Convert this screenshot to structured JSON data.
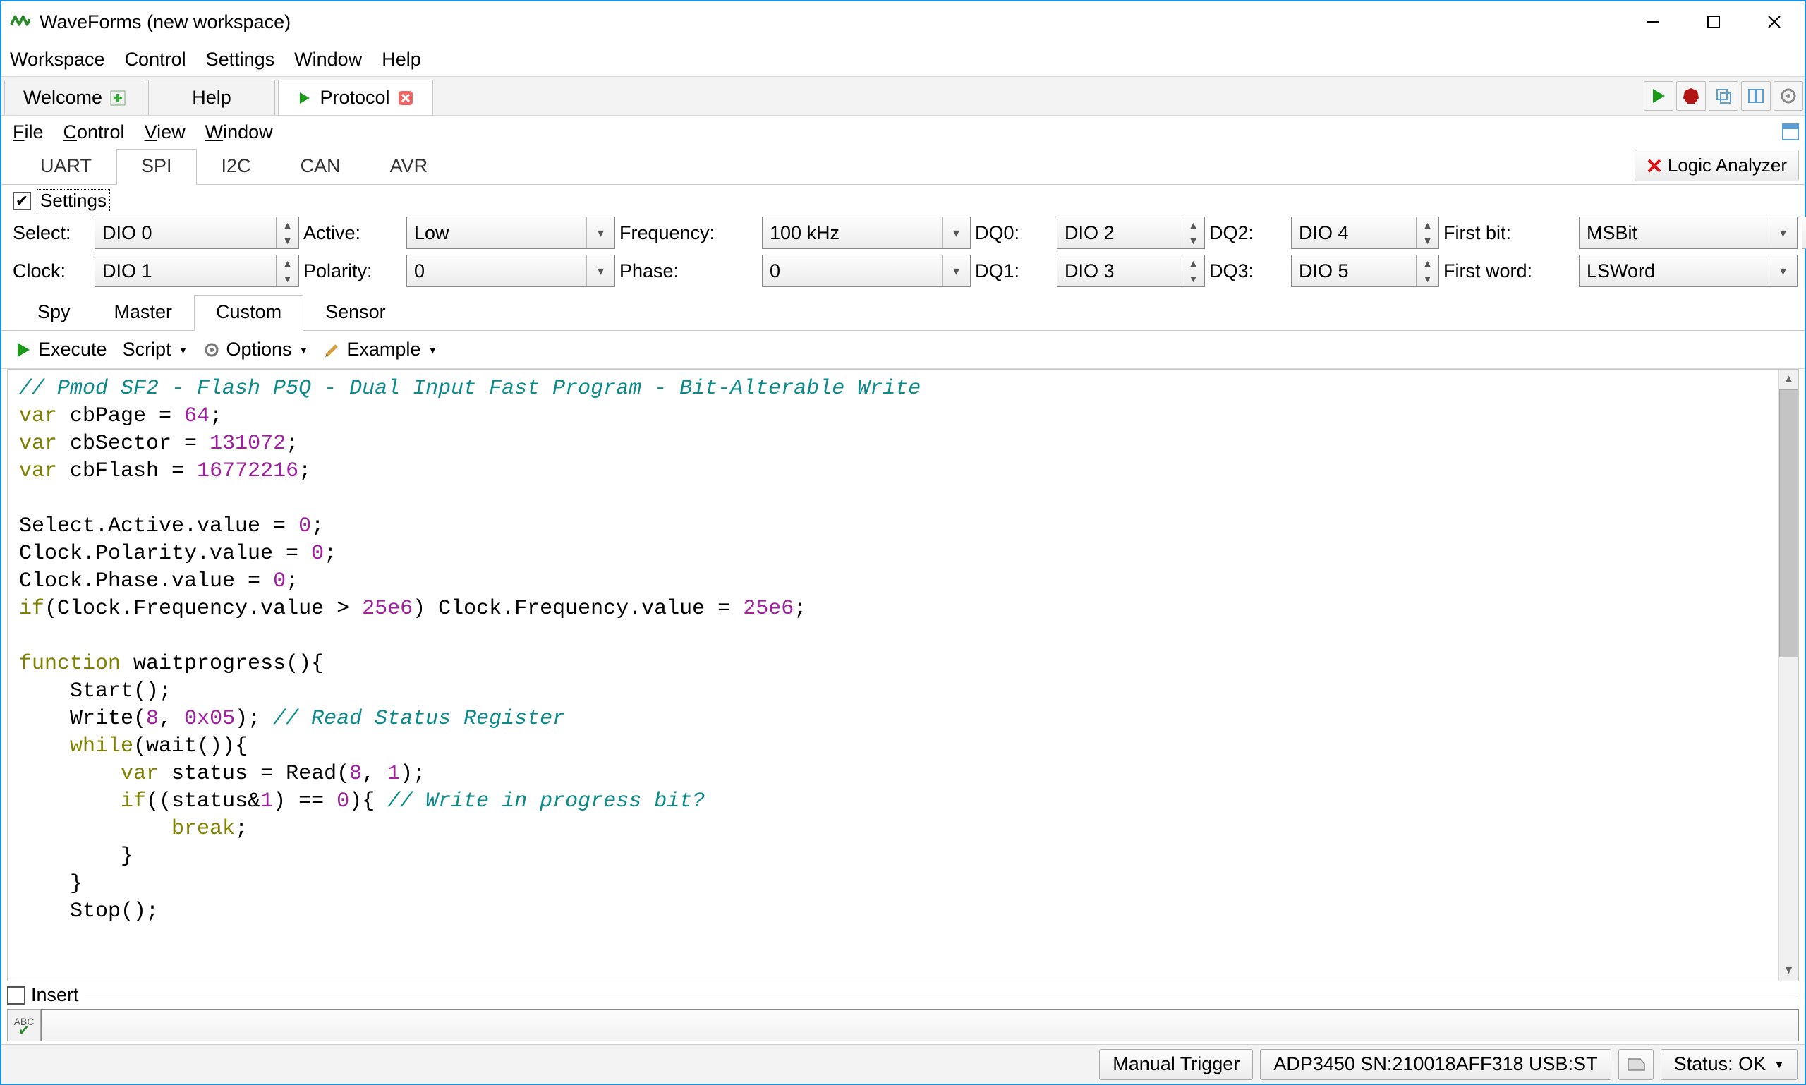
{
  "title": "WaveForms (new workspace)",
  "menubar": [
    "Workspace",
    "Control",
    "Settings",
    "Window",
    "Help"
  ],
  "tabs1": {
    "welcome": "Welcome",
    "help": "Help",
    "protocol": "Protocol"
  },
  "submenu": [
    "File",
    "Control",
    "View",
    "Window"
  ],
  "logicAnalyzerBtn": "Logic Analyzer",
  "protocolTabs": [
    "UART",
    "SPI",
    "I2C",
    "CAN",
    "AVR"
  ],
  "protocolActive": "SPI",
  "settingsLabel": "Settings",
  "params": {
    "selectLabel": "Select:",
    "selectValue": "DIO 0",
    "activeLabel": "Active:",
    "activeValue": "Low",
    "frequencyLabel": "Frequency:",
    "frequencyValue": "100 kHz",
    "dq0Label": "DQ0:",
    "dq0Value": "DIO 2",
    "dq2Label": "DQ2:",
    "dq2Value": "DIO 4",
    "firstbitLabel": "First bit:",
    "firstbitValue": "MSBit",
    "clockLabel": "Clock:",
    "clockValue": "DIO 1",
    "polarityLabel": "Polarity:",
    "polarityValue": "0",
    "phaseLabel": "Phase:",
    "phaseValue": "0",
    "dq1Label": "DQ1:",
    "dq1Value": "DIO 3",
    "dq3Label": "DQ3:",
    "dq3Value": "DIO 5",
    "firstwordLabel": "First word:",
    "firstwordValue": "LSWord"
  },
  "modeTabs": [
    "Spy",
    "Master",
    "Custom",
    "Sensor"
  ],
  "modeActive": "Custom",
  "scriptToolbar": {
    "execute": "Execute",
    "script": "Script",
    "options": "Options",
    "example": "Example"
  },
  "insertLabel": "Insert",
  "status": {
    "manual": "Manual Trigger",
    "device": "ADP3450 SN:210018AFF318 USB:ST",
    "status": "Status: OK"
  },
  "code": {
    "l1": "// Pmod SF2 - Flash P5Q - Dual Input Fast Program - Bit-Alterable Write",
    "l2a": "var",
    "l2b": " cbPage = ",
    "l2c": "64",
    "l2d": ";",
    "l3a": "var",
    "l3b": " cbSector = ",
    "l3c": "131072",
    "l3d": ";",
    "l4a": "var",
    "l4b": " cbFlash = ",
    "l4c": "16772216",
    "l4d": ";",
    "l6": "Select.Active.value = ",
    "l6n": "0",
    "l6e": ";",
    "l7": "Clock.Polarity.value = ",
    "l7n": "0",
    "l7e": ";",
    "l8": "Clock.Phase.value = ",
    "l8n": "0",
    "l8e": ";",
    "l9a": "if",
    "l9b": "(Clock.Frequency.value > ",
    "l9c": "25e6",
    "l9d": ") Clock.Frequency.value = ",
    "l9e": "25e6",
    "l9f": ";",
    "l11a": "function",
    "l11b": " waitprogress(){",
    "l12": "    Start();",
    "l13a": "    Write(",
    "l13b": "8",
    "l13c": ", ",
    "l13d": "0x05",
    "l13e": "); ",
    "l13f": "// Read Status Register",
    "l14a": "    ",
    "l14b": "while",
    "l14c": "(wait()){",
    "l15a": "        ",
    "l15b": "var",
    "l15c": " status = Read(",
    "l15d": "8",
    "l15e": ", ",
    "l15f": "1",
    "l15g": ");",
    "l16a": "        ",
    "l16b": "if",
    "l16c": "((status&",
    "l16d": "1",
    "l16e": ") == ",
    "l16f": "0",
    "l16g": "){ ",
    "l16h": "// Write in progress bit?",
    "l17a": "            ",
    "l17b": "break",
    "l17c": ";",
    "l18": "        }",
    "l19": "    }",
    "l20": "    Stop();"
  }
}
